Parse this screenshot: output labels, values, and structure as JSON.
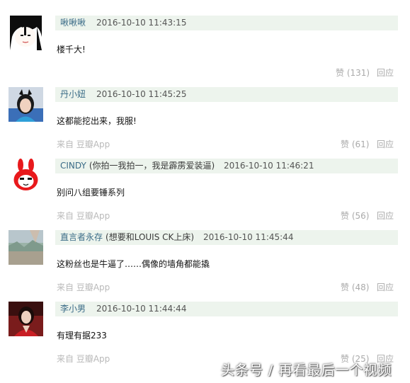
{
  "comments": [
    {
      "author": "啾啾啾",
      "note": "",
      "time": "2016-10-10 11:43:15",
      "text": "楼千大!",
      "source": "",
      "likes": "赞 (131)",
      "reply": "回应",
      "avatar": "avatar-cartoon-girl-icon"
    },
    {
      "author": "丹小妞",
      "note": "",
      "time": "2016-10-10 11:45:25",
      "text": "这都能挖出来，我服!",
      "source": "来自 豆瓣App",
      "likes": "赞 (61)",
      "reply": "回应",
      "avatar": "avatar-girl-photo-icon"
    },
    {
      "author": "CINDY",
      "note": "(你拍一我拍一，我是霹雳爱装逼)",
      "time": "2016-10-10 11:46:21",
      "text": "别问八组要锤系列",
      "source": "来自 豆瓣App",
      "likes": "赞 (56)",
      "reply": "回应",
      "avatar": "avatar-red-bunny-icon"
    },
    {
      "author": "直言者永存",
      "note": "(想要和LOUIS CK上床)",
      "time": "2016-10-10 11:45:44",
      "text": "这粉丝也是牛逼了……偶像的墙角都能撬",
      "source": "来自 豆瓣App",
      "likes": "赞 (48)",
      "reply": "回应",
      "avatar": "avatar-landscape-icon"
    },
    {
      "author": "李小男",
      "note": "",
      "time": "2016-10-10 11:44:44",
      "text": "有理有据233",
      "source": "来自 豆瓣App",
      "likes": "赞 (25)",
      "reply": "回应",
      "avatar": "avatar-woman-photo-icon"
    }
  ],
  "watermark": "头条号 / 再看最后一个视频"
}
